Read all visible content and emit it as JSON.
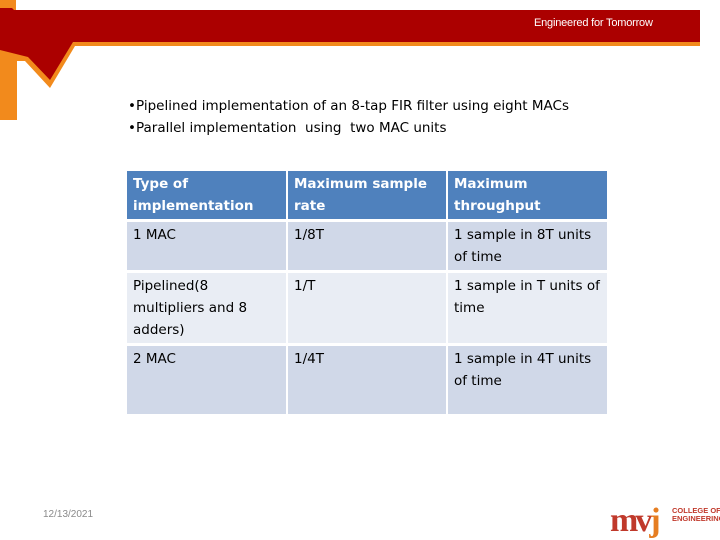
{
  "header": {
    "tagline": "Engineered for Tomorrow",
    "colors": {
      "banner": "#ab0000",
      "accent": "#f28a1c"
    }
  },
  "bullets": [
    "Pipelined implementation of an 8-tap FIR filter using eight MACs",
    "Parallel implementation  using  two MAC units"
  ],
  "table": {
    "headers": [
      "Type of implementation",
      "Maximum sample rate",
      "Maximum throughput"
    ],
    "rows": [
      [
        "1 MAC",
        "1/8T",
        "1 sample in 8T units of time"
      ],
      [
        "Pipelined(8 multipliers and 8 adders)",
        "1/T",
        "1 sample in T units of time"
      ],
      [
        "2 MAC",
        "1/4T",
        "1 sample in 4T units of time"
      ]
    ],
    "colors": {
      "header_bg": "#4f81bd",
      "row_odd": "#d0d8e8",
      "row_even": "#e9edf4"
    }
  },
  "footer": {
    "date": "12/13/2021",
    "logo": {
      "mark": "mv",
      "mark_j": "j",
      "line1": "COLLEGE OF",
      "line2": "ENGINEERING"
    }
  }
}
